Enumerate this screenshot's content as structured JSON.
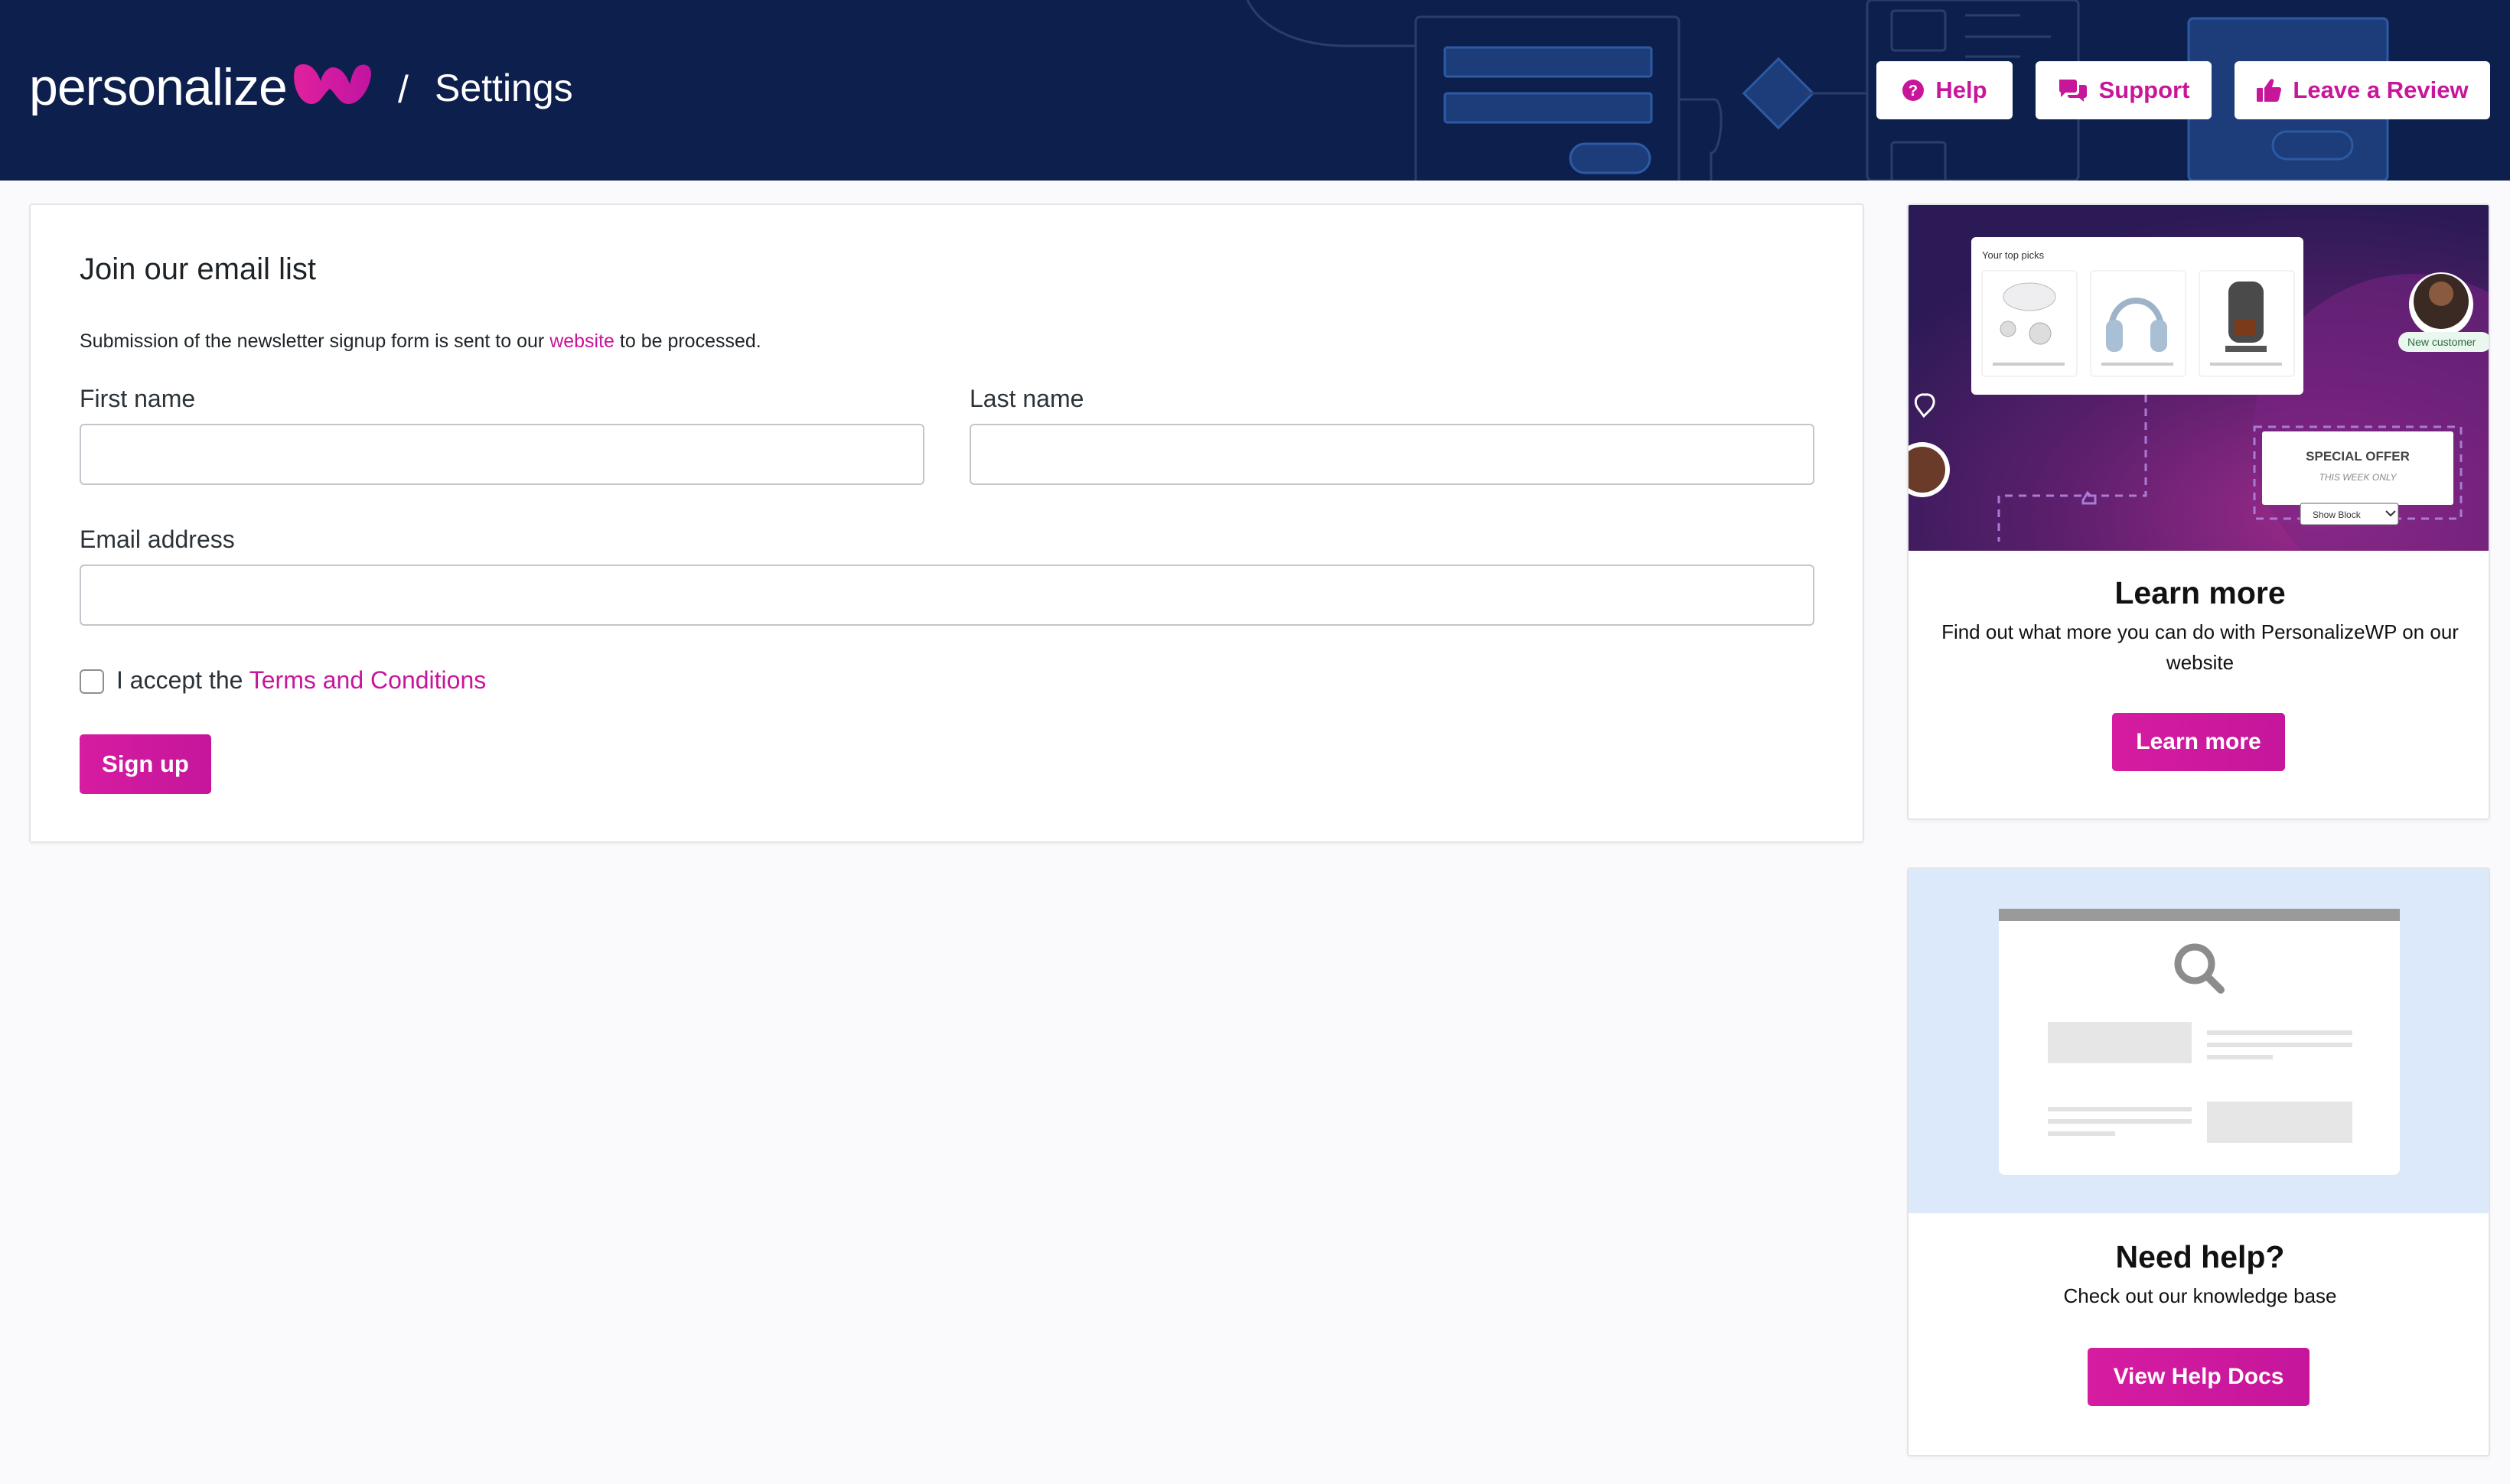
{
  "header": {
    "brand": "personalize",
    "separator": "/",
    "page_title": "Settings",
    "buttons": {
      "help": "Help",
      "support": "Support",
      "review": "Leave a Review"
    }
  },
  "form": {
    "title": "Join our email list",
    "desc_before": "Submission of the newsletter signup form is sent to our ",
    "desc_link": "website",
    "desc_after": " to be processed.",
    "first_name_label": "First name",
    "first_name_value": "",
    "last_name_label": "Last name",
    "last_name_value": "",
    "email_label": "Email address",
    "email_value": "",
    "accept_text": "I accept the ",
    "terms_link": "Terms and Conditions",
    "terms_checked": false,
    "submit_label": "Sign up"
  },
  "learn_more": {
    "illustration": {
      "top_picks": "Your top picks",
      "new_customer": "New customer",
      "special_offer": "SPECIAL OFFER",
      "this_week": "THIS WEEK ONLY",
      "show_block": "Show Block"
    },
    "title": "Learn more",
    "desc": "Find out what more you can do with PersonalizeWP on our website",
    "button": "Learn more"
  },
  "help_docs": {
    "title": "Need help?",
    "desc": "Check out our knowledge base",
    "button": "View Help Docs"
  },
  "colors": {
    "accent": "#c8169a",
    "header_bg": "#0d1f4d"
  },
  "icons": [
    "question-circle-icon",
    "comments-icon",
    "thumbs-up-icon",
    "magnifier-icon"
  ]
}
